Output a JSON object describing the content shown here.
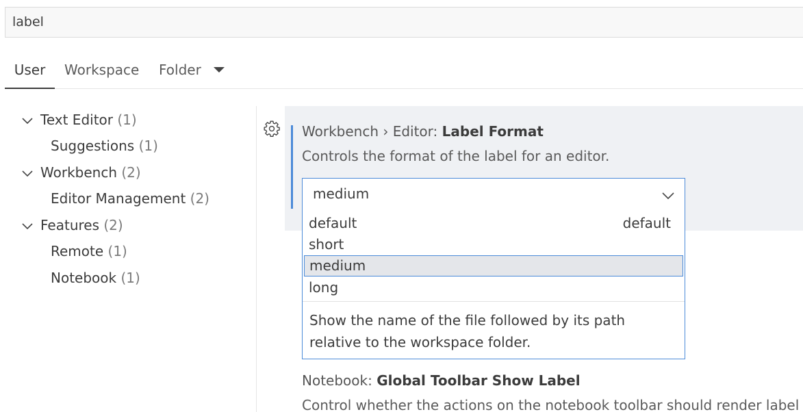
{
  "search": {
    "value": "label"
  },
  "tabs": [
    {
      "label": "User",
      "active": true
    },
    {
      "label": "Workspace",
      "active": false
    },
    {
      "label": "Folder",
      "active": false
    }
  ],
  "toc": [
    {
      "label": "Text Editor",
      "count": "(1)",
      "expanded": true
    },
    {
      "label": "Suggestions",
      "count": "(1)"
    },
    {
      "label": "Workbench",
      "count": "(2)",
      "expanded": true
    },
    {
      "label": "Editor Management",
      "count": "(2)"
    },
    {
      "label": "Features",
      "count": "(2)",
      "expanded": true
    },
    {
      "label": "Remote",
      "count": "(1)"
    },
    {
      "label": "Notebook",
      "count": "(1)"
    }
  ],
  "setting1": {
    "category": "Workbench › Editor: ",
    "name": "Label Format",
    "description": "Controls the format of the label for an editor.",
    "value": "medium",
    "options": [
      {
        "label": "default",
        "tag": "default"
      },
      {
        "label": "short"
      },
      {
        "label": "medium",
        "selected": true
      },
      {
        "label": "long"
      }
    ],
    "option_description": "Show the name of the file followed by its path relative to the workspace folder."
  },
  "setting2": {
    "category": "Notebook: ",
    "name": "Global Toolbar Show Label",
    "description": "Control whether the actions on the notebook toolbar should render label"
  },
  "colors": {
    "accent": "#4a8ad8",
    "row_bg": "#eff1f4",
    "selected_bg": "#e4e6ea"
  },
  "icons": {
    "gear": "gear-icon",
    "chevron": "chevron-down-icon"
  }
}
